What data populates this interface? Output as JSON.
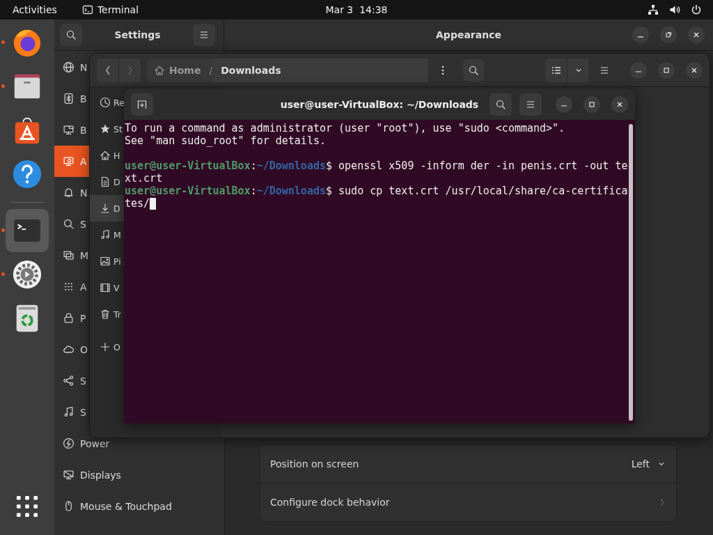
{
  "top_bar": {
    "activities": "Activities",
    "app": "Terminal",
    "clock": "Mar 3  14:38"
  },
  "dock": {
    "favorites": [
      {
        "kind": "browser",
        "running": true,
        "selected": false
      },
      {
        "kind": "files",
        "running": true,
        "selected": false
      },
      {
        "kind": "store",
        "running": false,
        "selected": false
      },
      {
        "kind": "help",
        "running": false,
        "selected": false
      }
    ],
    "open_apps": [
      {
        "kind": "terminal",
        "running": true,
        "selected": true
      },
      {
        "kind": "settings",
        "running": true,
        "selected": false
      },
      {
        "kind": "trash",
        "running": false,
        "selected": false
      }
    ]
  },
  "settings": {
    "title": "Settings",
    "page_title": "Appearance",
    "sidebar": [
      {
        "kind": "network",
        "label": "N",
        "selected": false
      },
      {
        "kind": "bluetooth",
        "label": "B",
        "selected": false
      },
      {
        "kind": "background",
        "label": "B",
        "selected": false
      },
      {
        "kind": "appearance",
        "label": "A",
        "selected": true
      },
      {
        "kind": "notifications",
        "label": "N",
        "selected": false
      },
      {
        "kind": "search",
        "label": "S",
        "selected": false
      },
      {
        "kind": "multitasking",
        "label": "M",
        "selected": false
      },
      {
        "kind": "apps",
        "label": "A",
        "selected": false
      },
      {
        "kind": "privacy",
        "label": "P",
        "selected": false
      },
      {
        "kind": "online-accounts",
        "label": "O",
        "selected": false
      },
      {
        "kind": "sharing",
        "label": "S",
        "selected": false
      },
      {
        "kind": "sound",
        "label": "S",
        "selected": false
      },
      {
        "kind": "power",
        "label": "Power",
        "selected": false
      },
      {
        "kind": "displays",
        "label": "Displays",
        "selected": false
      },
      {
        "kind": "mouse",
        "label": "Mouse & Touchpad",
        "selected": false
      }
    ],
    "dock_rows": [
      {
        "kind": "dropdown",
        "label": "Position on screen",
        "value": "Left"
      },
      {
        "kind": "link",
        "label": "Configure dock behavior"
      }
    ]
  },
  "files": {
    "path": {
      "home": "Home",
      "separator": "/",
      "current": "Downloads"
    },
    "sidebar": [
      {
        "kind": "recent",
        "label": "Re",
        "selected": false
      },
      {
        "kind": "starred",
        "label": "St",
        "selected": false
      },
      {
        "kind": "home",
        "label": "H",
        "selected": false
      },
      {
        "kind": "documents",
        "label": "D",
        "selected": false
      },
      {
        "kind": "downloads",
        "label": "D",
        "selected": true
      },
      {
        "kind": "music",
        "label": "M",
        "selected": false
      },
      {
        "kind": "pictures",
        "label": "Pi",
        "selected": false
      },
      {
        "kind": "videos",
        "label": "V",
        "selected": false
      },
      {
        "kind": "trash",
        "label": "Tr",
        "selected": false
      },
      {
        "kind": "other",
        "label": "O",
        "selected": false
      }
    ]
  },
  "terminal": {
    "title": "user@user-VirtualBox: ~/Downloads",
    "lines": [
      {
        "kind": "output",
        "text": "To run a command as administrator (user \"root\"), use \"sudo <command>\".",
        "cursor": false
      },
      {
        "kind": "output",
        "text": "See \"man sudo_root\" for details.",
        "cursor": false
      },
      {
        "kind": "blank"
      },
      {
        "kind": "prompt",
        "user": "user@user-VirtualBox",
        "sep": ":",
        "path": "~/Downloads",
        "dollar": "$",
        "command": " openssl x509 -inform der -in penis.crt -out te"
      },
      {
        "kind": "output",
        "text": "xt.crt",
        "cursor": false
      },
      {
        "kind": "prompt",
        "user": "user@user-VirtualBox",
        "sep": ":",
        "path": "~/Downloads",
        "dollar": "$",
        "command": " sudo cp text.crt /usr/local/share/ca-certifica"
      },
      {
        "kind": "output",
        "text": "tes/",
        "cursor": true
      }
    ]
  }
}
